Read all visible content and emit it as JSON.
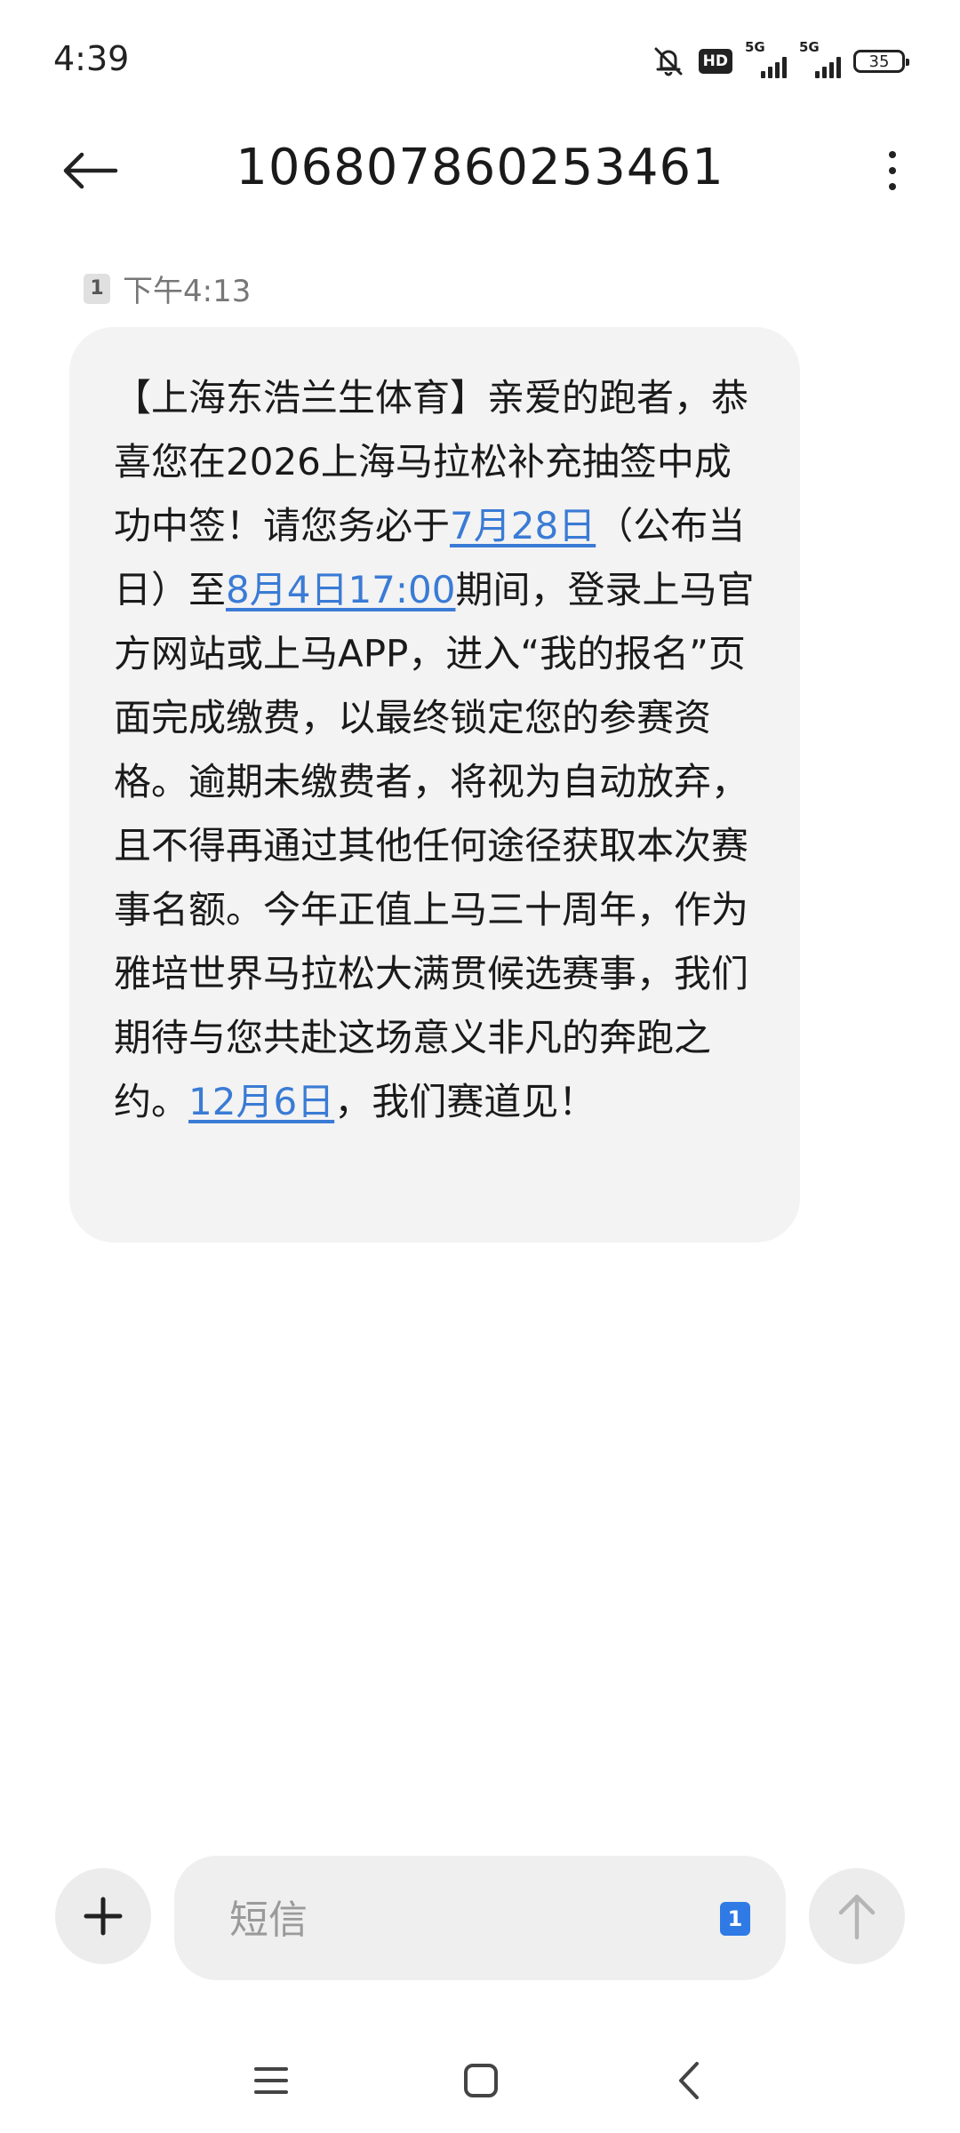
{
  "status_bar": {
    "time": "4:39",
    "hd_label": "HD",
    "sim1_network": "5G",
    "sim2_network": "5G",
    "battery_level": "35",
    "icons": [
      "mute-icon",
      "hd-voice-icon",
      "signal-icon",
      "signal-icon",
      "battery-icon"
    ]
  },
  "header": {
    "title": "106807860253461",
    "back_icon": "arrow-left-icon",
    "more_icon": "more-vertical-icon"
  },
  "message": {
    "sim_slot": "1",
    "time": "下午4:13",
    "segments": [
      {
        "text": "【上海东浩兰生体育】亲爱的跑者，恭喜您在2026上海马拉松补充抽签中成功中签！请您务必于",
        "link": false
      },
      {
        "text": "7月28日",
        "link": true
      },
      {
        "text": "（公布当日）至",
        "link": false
      },
      {
        "text": "8月4日17:00",
        "link": true
      },
      {
        "text": "期间，登录上马官方网站或上马APP，进入“我的报名”页面完成缴费，以最终锁定您的参赛资格。逾期未缴费者，将视为自动放弃，且不得再通过其他任何途径获取本次赛事名额。今年正值上马三十周年，作为雅培世界马拉松大满贯候选赛事，我们期待与您共赴这场意义非凡的奔跑之约。",
        "link": false
      },
      {
        "text": "12月6日",
        "link": true
      },
      {
        "text": "，我们赛道见！",
        "link": false
      }
    ]
  },
  "composer": {
    "placeholder": "短信",
    "value": "",
    "sim_slot": "1",
    "add_icon": "plus-icon",
    "send_icon": "arrow-up-icon"
  },
  "nav_bar": {
    "icons": [
      "menu-icon",
      "home-square-icon",
      "back-chevron-icon"
    ]
  },
  "colors": {
    "link": "#3a7bd5",
    "bubble_bg": "#f3f3f3",
    "sim_badge_active": "#2f7ae5"
  }
}
